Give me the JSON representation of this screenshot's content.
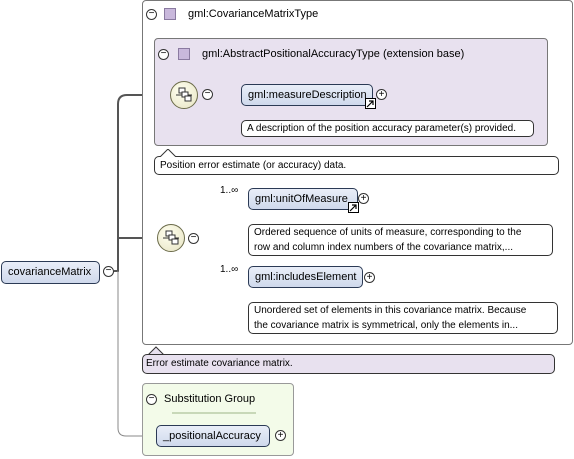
{
  "diagram": {
    "root_element": "covarianceMatrix",
    "complex_type": {
      "name": "gml:CovarianceMatrixType",
      "extension_base": {
        "name": "gml:AbstractPositionalAccuracyType (extension base)",
        "element": {
          "name": "gml:measureDescription",
          "doc": "A description of the position accuracy parameter(s) provided."
        },
        "doc": "Position error estimate (or accuracy) data."
      },
      "children": [
        {
          "name": "gml:unitOfMeasure",
          "multiplicity": "1..∞",
          "doc_line1": "Ordered sequence of units of measure, corresponding to the",
          "doc_line2": "row and column index numbers of the covariance matrix,..."
        },
        {
          "name": "gml:includesElement",
          "multiplicity": "1..∞",
          "doc_line1": "Unordered set of elements in this covariance matrix. Because",
          "doc_line2": "the covariance matrix is symmetrical, only the elements in..."
        }
      ]
    },
    "root_doc": "Error estimate covariance matrix.",
    "substitution_group": {
      "title": "Substitution Group",
      "element": "_positionalAccuracy"
    },
    "colors": {
      "element_fill": "#cfd9ec",
      "type_fill": "#e8e1ef",
      "substitution_fill": "#f3fbe9",
      "connector": "#555555"
    },
    "icons": {
      "collapse": "minus-circle",
      "expand": "plus-circle",
      "sequence": "sequence-compositor",
      "reference": "reference-arrow",
      "type": "complex-type-square"
    }
  }
}
